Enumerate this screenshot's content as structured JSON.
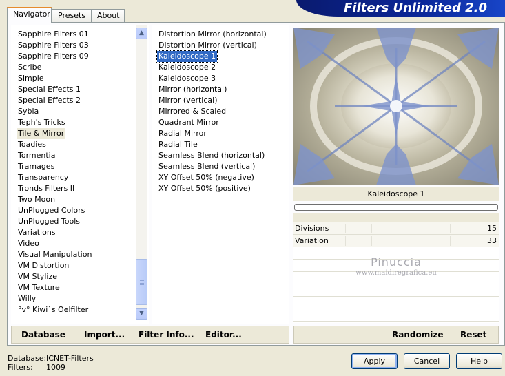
{
  "tabs": [
    "Navigator",
    "Presets",
    "About"
  ],
  "app_title": "Filters Unlimited 2.0",
  "categories": {
    "items": [
      "Sapphire Filters 01",
      "Sapphire Filters 03",
      "Sapphire Filters 09",
      "Scribe",
      "Simple",
      "Special Effects 1",
      "Special Effects 2",
      "Sybia",
      "Teph's Tricks",
      "Tile & Mirror",
      "Toadies",
      "Tormentia",
      "Tramages",
      "Transparency",
      "Tronds Filters II",
      "Two Moon",
      "UnPlugged Colors",
      "UnPlugged Tools",
      "Variations",
      "Video",
      "Visual Manipulation",
      "VM Distortion",
      "VM Stylize",
      "VM Texture",
      "Willy",
      "°v° Kiwi`s Oelfilter"
    ],
    "selected": "Tile & Mirror"
  },
  "filters": {
    "items": [
      "Distortion Mirror (horizontal)",
      "Distortion Mirror (vertical)",
      "Kaleidoscope 1",
      "Kaleidoscope 2",
      "Kaleidoscope 3",
      "Mirror (horizontal)",
      "Mirror (vertical)",
      "Mirrored & Scaled",
      "Quadrant Mirror",
      "Radial Mirror",
      "Radial Tile",
      "Seamless Blend (horizontal)",
      "Seamless Blend (vertical)",
      "XY Offset 50% (negative)",
      "XY Offset 50% (positive)"
    ],
    "selected": "Kaleidoscope 1"
  },
  "preview": {
    "filter_name": "Kaleidoscope 1",
    "progress": 0
  },
  "params": [
    {
      "name": "Divisions",
      "value": "15"
    },
    {
      "name": "Variation",
      "value": "33"
    }
  ],
  "watermark": {
    "line1": "Pinuccia",
    "line2": "www.maidiregrafica.eu"
  },
  "links": {
    "database": "Database",
    "import": "Import...",
    "filter_info": "Filter Info...",
    "editor": "Editor...",
    "randomize": "Randomize",
    "reset": "Reset"
  },
  "footer": {
    "database_label": "Database:",
    "database_value": "ICNET-Filters",
    "filters_label": "Filters:",
    "filters_value": "1009"
  },
  "buttons": {
    "apply": "Apply",
    "cancel": "Cancel",
    "help": "Help"
  },
  "colors": {
    "accent": "#316ac5",
    "banner": "#0b2799",
    "tab_highlight": "#e68b2c"
  }
}
